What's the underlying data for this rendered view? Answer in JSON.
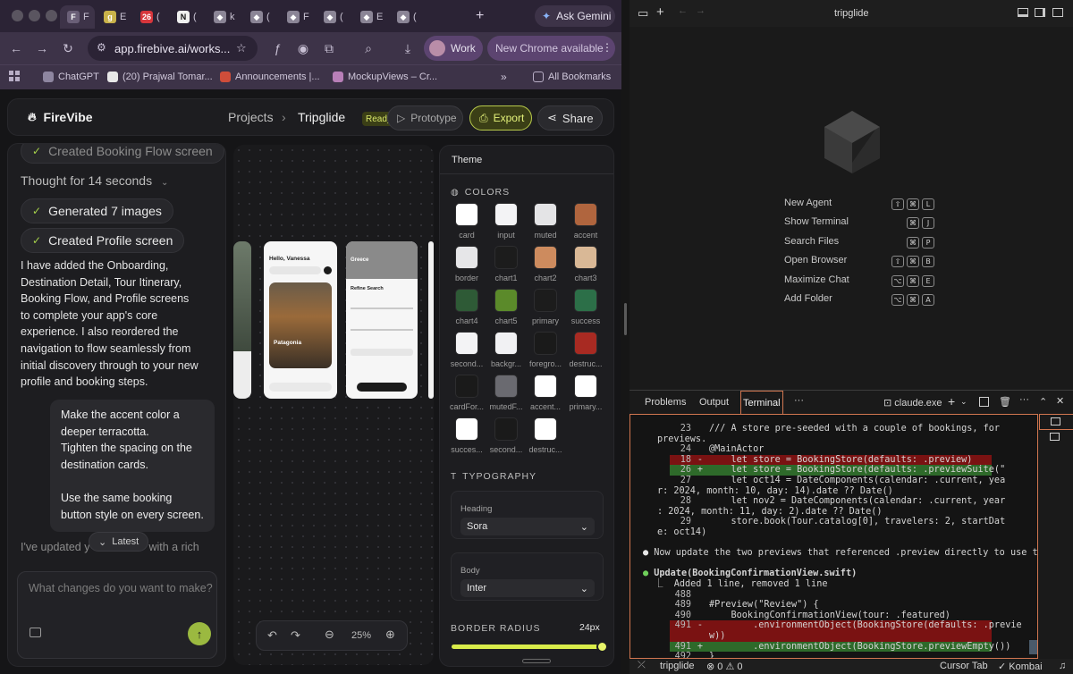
{
  "browser": {
    "tabs": [
      {
        "letter": "F",
        "color": "#6a5f77",
        "active": true
      },
      {
        "letter": "g",
        "color": "#c9b24a",
        "active": false
      },
      {
        "letter": "26",
        "color": "#d7363c",
        "active": false
      },
      {
        "letter": "N",
        "color": "#f0f0f0",
        "active": false
      },
      {
        "letter": "◆",
        "color": "#8b8596",
        "active": false
      },
      {
        "letter": "◆",
        "color": "#8b8596",
        "active": false
      },
      {
        "letter": "◆",
        "color": "#8b8596",
        "active": false
      },
      {
        "letter": "◆",
        "color": "#8b8596",
        "active": false
      },
      {
        "letter": "◆",
        "color": "#8b8596",
        "active": false
      },
      {
        "letter": "◆",
        "color": "#8b8596",
        "active": false
      }
    ],
    "tab_text": [
      "F",
      "E",
      "(",
      "(",
      "k",
      "(",
      "F",
      "(",
      "E",
      "("
    ],
    "ask_gemini": "Ask Gemini",
    "url": "app.firebive.ai/works...",
    "work_label": "Work",
    "update_label": "New Chrome available",
    "bookmarks": [
      "ChatGPT",
      "(20) Prajwal Tomar...",
      "Announcements |...",
      "MockupViews – Cr..."
    ],
    "all_bookmarks": "All Bookmarks"
  },
  "app": {
    "brand": "FireVibe",
    "breadcrumb_projects": "Projects",
    "breadcrumb_sep": "›",
    "project_name": "Tripglide",
    "status": "Ready",
    "prototype": "Prototype",
    "export": "Export",
    "share": "Share"
  },
  "chat": {
    "prev_chip": "Created Booking Flow screen",
    "thought": "Thought for 14 seconds",
    "chips": [
      "Generated 7 images",
      "Created Profile screen"
    ],
    "assistant_msg": "I have added the Onboarding, Destination Detail, Tour Itinerary, Booking Flow, and Profile screens to complete your app's core experience. I also reordered the navigation to flow seamlessly from initial discovery through to your new profile and booking steps.",
    "user_msg_1": "Make the accent color a deeper terracotta.",
    "user_msg_2": "Tighten the spacing on the destination cards.",
    "user_msg_3": "Use the same booking button style on every screen.",
    "trailing": "I've updated y",
    "trailing_end": "with a rich",
    "latest": "Latest",
    "composer_placeholder": "What changes do you want to make?"
  },
  "canvas": {
    "zoom": "25%",
    "phone1_greeting": "Hello, Vanessa",
    "phone1_card_title": "Patagonia",
    "phone2_title": "Refine Search",
    "phone3_title": "Greece"
  },
  "theme": {
    "tab": "Theme",
    "colors_title": "COLORS",
    "swatches": [
      {
        "name": "card",
        "color": "#ffffff"
      },
      {
        "name": "input",
        "color": "#f3f3f5"
      },
      {
        "name": "muted",
        "color": "#e4e4e6"
      },
      {
        "name": "accent",
        "color": "#b0653e"
      },
      {
        "name": "border",
        "color": "#e6e6e8"
      },
      {
        "name": "chart1",
        "color": "#1c1c1c"
      },
      {
        "name": "chart2",
        "color": "#cd8b5e"
      },
      {
        "name": "chart3",
        "color": "#d9b896"
      },
      {
        "name": "chart4",
        "color": "#2e5a36"
      },
      {
        "name": "chart5",
        "color": "#5b8a2a"
      },
      {
        "name": "primary",
        "color": "#1c1c1c"
      },
      {
        "name": "success",
        "color": "#2c6f48"
      },
      {
        "name": "second...",
        "color": "#f3f3f5"
      },
      {
        "name": "backgr...",
        "color": "#f1f1f3"
      },
      {
        "name": "foregro...",
        "color": "#1a1a1a"
      },
      {
        "name": "destruc...",
        "color": "#a82a22"
      },
      {
        "name": "cardFor...",
        "color": "#1a1a1a"
      },
      {
        "name": "mutedF...",
        "color": "#6a6a70"
      },
      {
        "name": "accent...",
        "color": "#ffffff"
      },
      {
        "name": "primary...",
        "color": "#ffffff"
      },
      {
        "name": "succes...",
        "color": "#ffffff"
      },
      {
        "name": "second...",
        "color": "#1a1a1a"
      },
      {
        "name": "destruc...",
        "color": "#ffffff"
      }
    ],
    "typography_title": "TYPOGRAPHY",
    "heading_label": "Heading",
    "heading_font": "Sora",
    "body_label": "Body",
    "body_font": "Inter",
    "radius_label": "BORDER RADIUS",
    "radius_value": "24px",
    "radius_level": 1.0
  },
  "ide": {
    "title": "tripglide",
    "menu": [
      {
        "label": "New Agent",
        "keys": [
          "⇧",
          "⌘",
          "L"
        ]
      },
      {
        "label": "Show Terminal",
        "keys": [
          "⌘",
          "J"
        ]
      },
      {
        "label": "Search Files",
        "keys": [
          "⌘",
          "P"
        ]
      },
      {
        "label": "Open Browser",
        "keys": [
          "⇧",
          "⌘",
          "B"
        ]
      },
      {
        "label": "Maximize Chat",
        "keys": [
          "⌥",
          "⌘",
          "E"
        ]
      },
      {
        "label": "Add Folder",
        "keys": [
          "⌥",
          "⌘",
          "A"
        ]
      }
    ],
    "panel_tabs": [
      "Problems",
      "Output",
      "Terminal"
    ],
    "terminal_name": "claude.exe",
    "status_left": "tripglide",
    "status_problems": "⊗ 0 ⚠ 0",
    "status_cursor_tab": "Cursor Tab",
    "status_kombai": "✓ Kombai"
  },
  "terminal": {
    "lines": [
      {
        "type": "ctx",
        "num": "23",
        "mark": " ",
        "text": "/// A store pre-seeded with a couple of bookings, for"
      },
      {
        "type": "ctx",
        "num": "",
        "mark": "",
        "text": "previews."
      },
      {
        "type": "ctx",
        "num": "24",
        "mark": " ",
        "text": "@MainActor"
      },
      {
        "type": "rem",
        "num": "18",
        "mark": "-",
        "text": "    let store = BookingStore(defaults: .preview)"
      },
      {
        "type": "add",
        "num": "26",
        "mark": "+",
        "text": "    let store = BookingStore(defaults: .previewSuite(\""
      },
      {
        "type": "ctx",
        "num": "27",
        "mark": " ",
        "text": "    let oct14 = DateComponents(calendar: .current, yea"
      },
      {
        "type": "ctx",
        "num": "",
        "mark": "",
        "text": "r: 2024, month: 10, day: 14).date ?? Date()"
      },
      {
        "type": "ctx",
        "num": "28",
        "mark": " ",
        "text": "    let nov2 = DateComponents(calendar: .current, year"
      },
      {
        "type": "ctx",
        "num": "",
        "mark": "",
        "text": ": 2024, month: 11, day: 2).date ?? Date()"
      },
      {
        "type": "ctx",
        "num": "29",
        "mark": " ",
        "text": "    store.book(Tour.catalog[0], travelers: 2, startDat"
      },
      {
        "type": "ctx",
        "num": "",
        "mark": "",
        "text": "e: oct14)"
      },
      {
        "type": "blank",
        "num": "",
        "mark": "",
        "text": ""
      },
      {
        "type": "msg",
        "num": "",
        "mark": "",
        "text": "● Now update the two previews that referenced .preview directly to use the"
      },
      {
        "type": "blank",
        "num": "",
        "mark": "",
        "text": ""
      },
      {
        "type": "tool",
        "num": "",
        "mark": "",
        "text": "● Update(BookingConfirmationView.swift)"
      },
      {
        "type": "sub",
        "num": "",
        "mark": "",
        "text": "  ⎿  Added 1 line, removed 1 line"
      },
      {
        "type": "ctx",
        "num": "488",
        "mark": " ",
        "text": ""
      },
      {
        "type": "ctx",
        "num": "489",
        "mark": " ",
        "text": "#Preview(\"Review\") {"
      },
      {
        "type": "ctx",
        "num": "490",
        "mark": " ",
        "text": "    BookingConfirmationView(tour: .featured)"
      },
      {
        "type": "rem",
        "num": "491",
        "mark": "-",
        "text": "        .environmentObject(BookingStore(defaults: .previe"
      },
      {
        "type": "rem2",
        "num": "",
        "mark": "",
        "text": "w))"
      },
      {
        "type": "add",
        "num": "491",
        "mark": "+",
        "text": "        .environmentObject(BookingStore.previewEmpty())"
      },
      {
        "type": "ctx",
        "num": "492",
        "mark": " ",
        "text": "}"
      }
    ]
  }
}
